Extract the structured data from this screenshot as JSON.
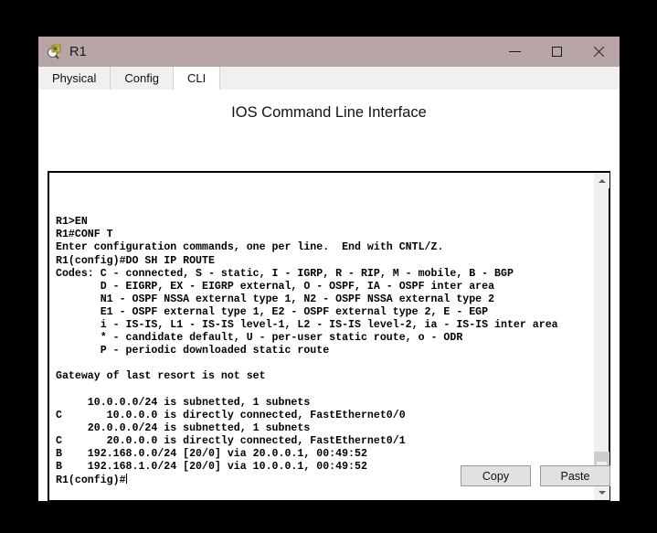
{
  "window": {
    "title": "R1",
    "icon": "router-icon",
    "controls": {
      "minimize": "minimize-icon",
      "maximize": "maximize-icon",
      "close": "close-icon"
    }
  },
  "tabs": [
    {
      "label": "Physical",
      "active": false
    },
    {
      "label": "Config",
      "active": false
    },
    {
      "label": "CLI",
      "active": true
    }
  ],
  "panel": {
    "title": "IOS Command Line Interface"
  },
  "terminal": {
    "lines": [
      "",
      "",
      "",
      "R1>EN",
      "R1#CONF T",
      "Enter configuration commands, one per line.  End with CNTL/Z.",
      "R1(config)#DO SH IP ROUTE",
      "Codes: C - connected, S - static, I - IGRP, R - RIP, M - mobile, B - BGP",
      "       D - EIGRP, EX - EIGRP external, O - OSPF, IA - OSPF inter area",
      "       N1 - OSPF NSSA external type 1, N2 - OSPF NSSA external type 2",
      "       E1 - OSPF external type 1, E2 - OSPF external type 2, E - EGP",
      "       i - IS-IS, L1 - IS-IS level-1, L2 - IS-IS level-2, ia - IS-IS inter area",
      "       * - candidate default, U - per-user static route, o - ODR",
      "       P - periodic downloaded static route",
      "",
      "Gateway of last resort is not set",
      "",
      "     10.0.0.0/24 is subnetted, 1 subnets",
      "C       10.0.0.0 is directly connected, FastEthernet0/0",
      "     20.0.0.0/24 is subnetted, 1 subnets",
      "C       20.0.0.0 is directly connected, FastEthernet0/1",
      "B    192.168.0.0/24 [20/0] via 20.0.0.1, 00:49:52",
      "B    192.168.1.0/24 [20/0] via 10.0.0.1, 00:49:52"
    ],
    "prompt": "R1(config)#"
  },
  "scrollbar": {
    "up_arrow": "chevron-up-icon",
    "down_arrow": "chevron-down-icon"
  },
  "buttons": {
    "copy": "Copy",
    "paste": "Paste"
  },
  "colors": {
    "titlebar": "#b7a5a5",
    "tabstrip": "#f0f0f0",
    "terminal_bg": "#ffffff",
    "terminal_fg": "#000000",
    "button_bg": "#e1e1e1",
    "desktop": "#000000"
  }
}
